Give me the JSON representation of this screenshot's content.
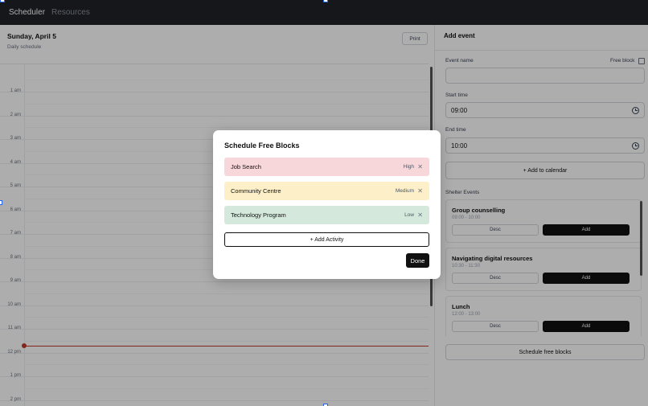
{
  "nav": {
    "items": [
      "Scheduler",
      "Resources"
    ]
  },
  "calendar": {
    "title": "Sunday, April 5",
    "subtitle": "Daily schedule",
    "print_label": "Print",
    "hours": [
      "1 am",
      "2 am",
      "3 am",
      "4 am",
      "5 am",
      "6 am",
      "7 am",
      "8 am",
      "9 am",
      "10 am",
      "11 am",
      "12 pm",
      "1 pm",
      "2 pm"
    ]
  },
  "add_event": {
    "title": "Add event",
    "event_name_label": "Event name",
    "event_name_value": "",
    "free_block_label": "Free block",
    "start_label": "Start time",
    "start_value": "09:00",
    "end_label": "End time",
    "end_value": "10:00",
    "add_button": "+ Add to calendar",
    "shelter_label": "Shelter Events",
    "events": [
      {
        "name": "Group counselling",
        "time": "09:00 - 10:00",
        "desc": "Desc",
        "add": "Add"
      },
      {
        "name": "Navigating digital resources",
        "time": "10:30 - 11:30",
        "desc": "Desc",
        "add": "Add"
      },
      {
        "name": "Lunch",
        "time": "12:00 - 13:00",
        "desc": "Desc",
        "add": "Add"
      }
    ],
    "schedule_button": "Schedule free blocks"
  },
  "modal": {
    "title": "Schedule Free Blocks",
    "activities": [
      {
        "name": "Job Search",
        "priority": "High",
        "color": "#f8d7da"
      },
      {
        "name": "Community Centre",
        "priority": "Medium",
        "color": "#fdf0c8"
      },
      {
        "name": "Technology Program",
        "priority": "Low",
        "color": "#d4e9dc"
      }
    ],
    "add_activity": "+ Add Activity",
    "done": "Done"
  }
}
